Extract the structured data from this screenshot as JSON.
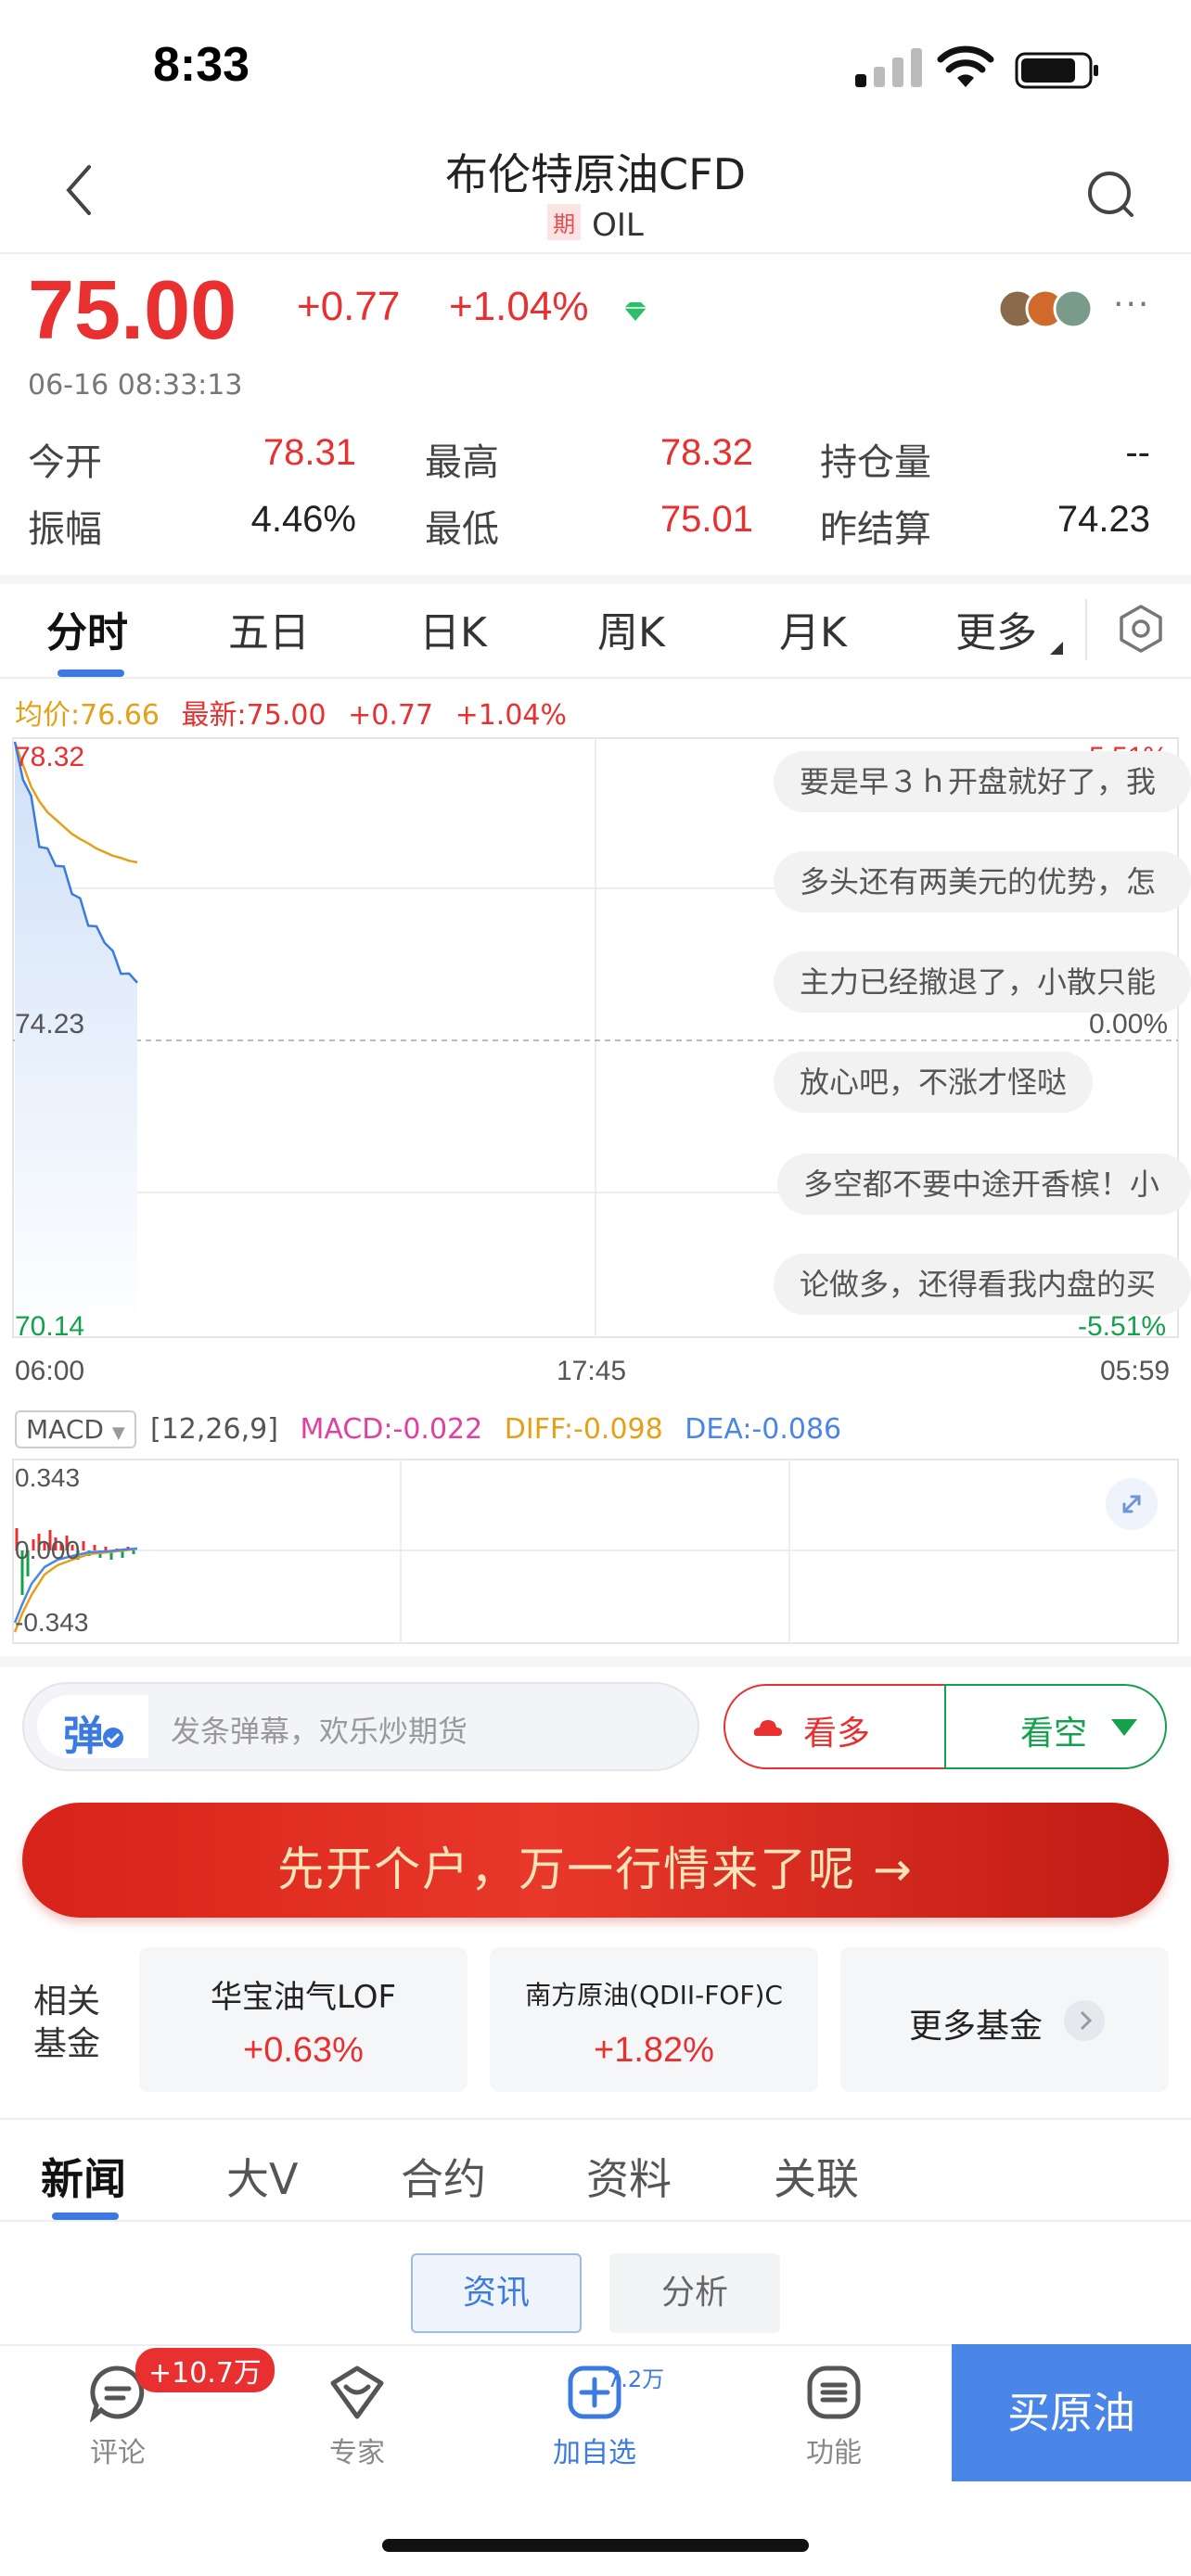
{
  "status_bar": {
    "time": "8:33"
  },
  "nav": {
    "title": "布伦特原油CFD",
    "tag": "期",
    "subtitle": "OIL"
  },
  "quote": {
    "price": "75.00",
    "change": "+0.77",
    "change_pct": "+1.04%",
    "timestamp": "06-16 08:33:13",
    "more": "···"
  },
  "stats": [
    {
      "label": "今开",
      "value": "78.31",
      "color": "red"
    },
    {
      "label": "最高",
      "value": "78.32",
      "color": "red"
    },
    {
      "label": "持仓量",
      "value": "--",
      "color": "dark"
    },
    {
      "label": "振幅",
      "value": "4.46%",
      "color": "dark"
    },
    {
      "label": "最低",
      "value": "75.01",
      "color": "red"
    },
    {
      "label": "昨结算",
      "value": "74.23",
      "color": "dark"
    }
  ],
  "chart_tabs": [
    "分时",
    "五日",
    "日K",
    "周K",
    "月K",
    "更多"
  ],
  "legend": {
    "avg": "均价:76.66",
    "latest": "最新:75.00",
    "change": "+0.77",
    "pct": "+1.04%"
  },
  "axis": {
    "y_top": "78.32",
    "y_mid": "74.23",
    "y_bot": "70.14",
    "pct_top": "5.51%",
    "pct_mid": "0.00%",
    "pct_bot": "-5.51%",
    "x_start": "06:00",
    "x_mid": "17:45",
    "x_end": "05:59"
  },
  "danmu": [
    "要是早３ｈ开盘就好了，我",
    "多头还有两美元的优势，怎",
    "主力已经撤退了，小散只能",
    "放心吧，不涨才怪哒",
    "多空都不要中途开香槟！小",
    "论做多，还得看我内盘的买"
  ],
  "macd": {
    "selector": "MACD",
    "params": "[12,26,9]",
    "macd": "MACD:-0.022",
    "diff": "DIFF:-0.098",
    "dea": "DEA:-0.086",
    "y_top": "0.343",
    "y_mid": "0.000",
    "y_bot": "-0.343"
  },
  "input": {
    "icon_label": "弹",
    "placeholder": "发条弹幕，欢乐炒期货"
  },
  "votes": {
    "bull": "看多",
    "bear": "看空"
  },
  "banner": {
    "text": "先开个户，万一行情来了呢 →"
  },
  "funds": {
    "label_line1": "相关",
    "label_line2": "基金",
    "items": [
      {
        "name": "华宝油气LOF",
        "pct": "+0.63%"
      },
      {
        "name": "南方原油(QDII-FOF)C",
        "pct": "+1.82%"
      }
    ],
    "more": "更多基金"
  },
  "news_tabs": [
    "新闻",
    "大V",
    "合约",
    "资料",
    "关联"
  ],
  "sub_tabs": [
    "资讯",
    "分析"
  ],
  "bottom_bar": {
    "comment_badge": "+10.7万",
    "comment": "评论",
    "expert": "专家",
    "watch_count": "7.2万",
    "add_watch": "加自选",
    "features": "功能",
    "buy": "买原油"
  },
  "chart_data": {
    "type": "line",
    "series": [
      {
        "values": [
          78.32,
          77.9,
          77.5,
          77.0,
          76.8,
          76.7,
          76.5,
          76.3,
          76.1,
          75.9,
          75.7,
          75.6,
          75.4,
          75.2,
          75.1,
          75.0
        ]
      },
      {
        "values": [
          78.32,
          78.0,
          77.7,
          77.5,
          77.35,
          77.25,
          77.15,
          77.05,
          76.98,
          76.92,
          76.85,
          76.8,
          76.75,
          76.72,
          76.68,
          76.66
        ]
      }
    ],
    "ylim": [
      70.14,
      78.32
    ]
  },
  "colors": {
    "accent": "#3b7ae0",
    "up": "#e93030",
    "down": "#14a14b",
    "avg": "#e6a017",
    "macd": "#e040a0"
  }
}
